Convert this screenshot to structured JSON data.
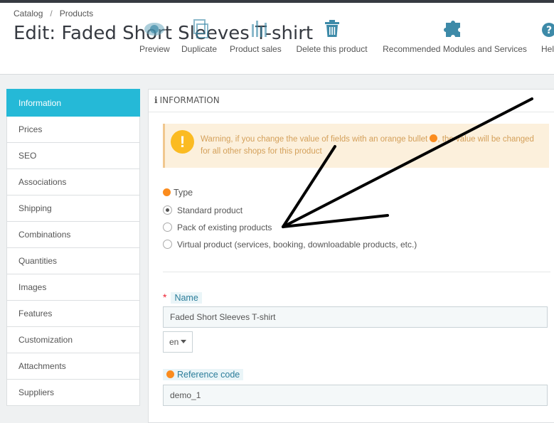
{
  "breadcrumb": {
    "items": [
      "Catalog",
      "Products"
    ],
    "separator": "/"
  },
  "page_title": "Edit: Faded Short Sleeves T-shirt",
  "toolbar": {
    "buttons": [
      {
        "label": "Preview",
        "icon": "eye-icon"
      },
      {
        "label": "Duplicate",
        "icon": "copy-icon"
      },
      {
        "label": "Product sales",
        "icon": "bar-chart-icon"
      },
      {
        "label": "Delete this product",
        "icon": "trash-icon"
      },
      {
        "label": "Recommended Modules and Services",
        "icon": "puzzle-icon"
      },
      {
        "label": "Help",
        "icon": "help-icon",
        "visible_text": "Hel"
      }
    ]
  },
  "sidebar": {
    "items": [
      "Information",
      "Prices",
      "SEO",
      "Associations",
      "Shipping",
      "Combinations",
      "Quantities",
      "Images",
      "Features",
      "Customization",
      "Attachments",
      "Suppliers"
    ],
    "active": "Information"
  },
  "panel": {
    "heading": "INFORMATION",
    "heading_icon": "info-icon",
    "warning": {
      "text_before": "Warning, if you change the value of fields with an orange bullet",
      "text_after": ", the value will be changed for all other shops for this product",
      "icon": "exclamation-icon"
    },
    "type": {
      "label": "Type",
      "options": [
        {
          "label": "Standard product",
          "checked": true
        },
        {
          "label": "Pack of existing products",
          "checked": false
        },
        {
          "label": "Virtual product (services, booking, downloadable products, etc.)",
          "checked": false
        }
      ]
    },
    "name": {
      "label": "Name",
      "required_mark": "*",
      "value": "Faded Short Sleeves T-shirt",
      "language": "en"
    },
    "reference": {
      "label": "Reference code",
      "value": "demo_1"
    }
  },
  "colors": {
    "accent": "#25b9d7",
    "orange_bullet": "#fb8c1e",
    "warning_bg": "#fcf0dc",
    "warning_text": "#d4a05a",
    "annotation": "#000000"
  }
}
